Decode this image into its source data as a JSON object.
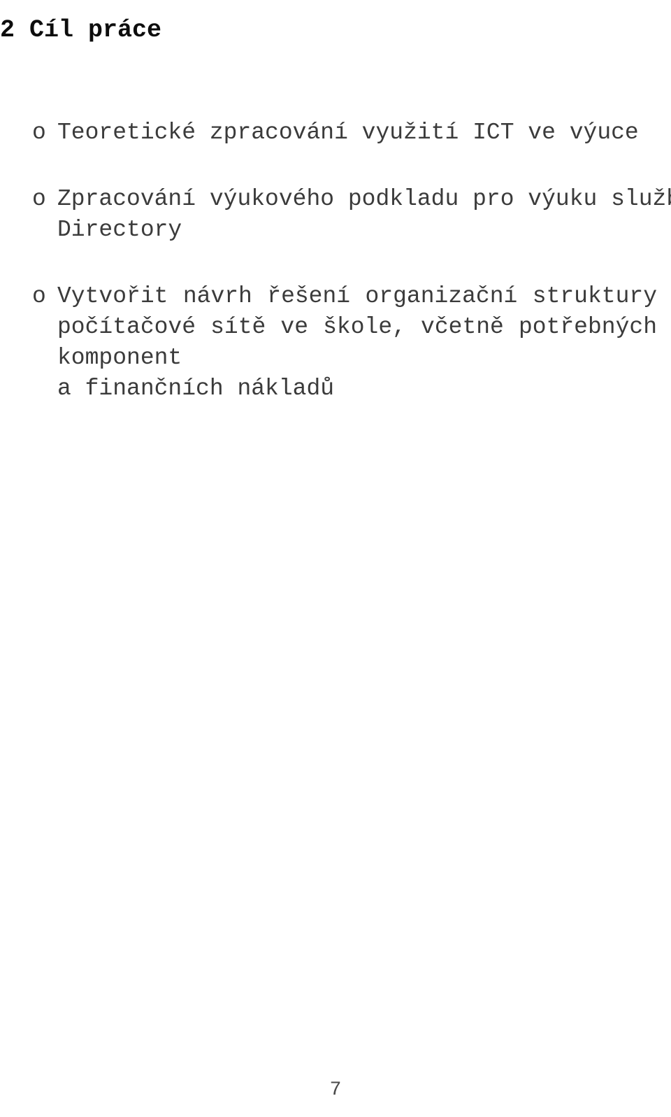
{
  "document": {
    "heading": "2 Cíl práce",
    "bullet_marker": "o",
    "items": [
      {
        "id": "teoreticke-zpracovani",
        "lines": [
          "Teoretické zpracování využití ICT ve výuce"
        ],
        "justified": false
      },
      {
        "id": "zpracovani-vykladoveho-podkladu",
        "lines": [
          "Zpracování výukového podkladu pro výuku služby Active",
          "Directory"
        ],
        "justified": false
      },
      {
        "id": "vytvorit-navrh-reseni",
        "lines": [
          "Vytvořit návrh řešení organizační struktury",
          "počítačové sítě ve škole, včetně potřebných komponent",
          "a finančních nákladů"
        ],
        "justified": true
      }
    ],
    "page_number": "7",
    "colors": {
      "heading": "#0d0d0d",
      "body_text": "#3b3b3b",
      "page_number": "#4a4a4a",
      "background": "#ffffff"
    }
  }
}
